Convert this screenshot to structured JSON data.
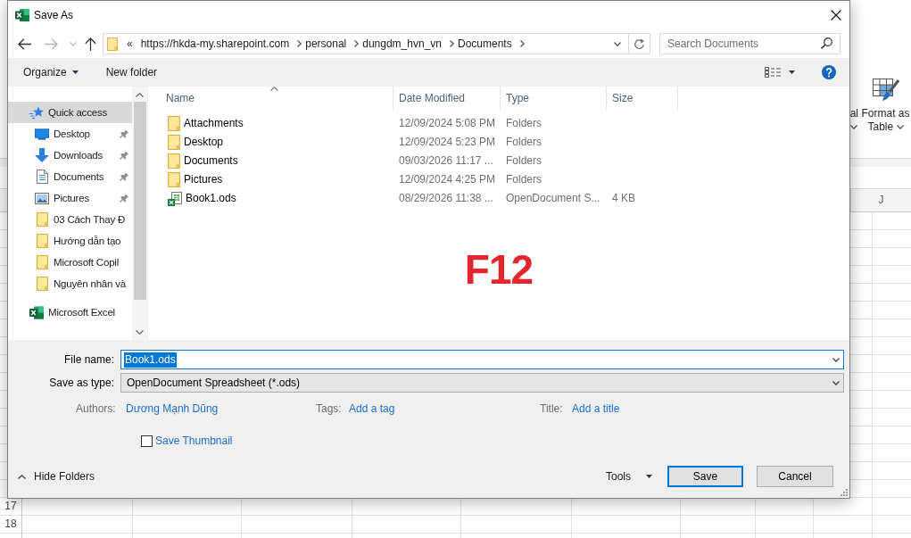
{
  "window": {
    "title": "Save As"
  },
  "nav_buttons": [
    {
      "kind": "back",
      "disabled": false
    },
    {
      "kind": "forward",
      "disabled": true
    },
    {
      "kind": "recent",
      "disabled": true
    },
    {
      "kind": "up",
      "disabled": false
    }
  ],
  "address_bar": {
    "overflow_marker": "«",
    "segments": [
      "https://hkda-my.sharepoint.com",
      "personal",
      "dungdm_hvn_vn",
      "Documents"
    ]
  },
  "search": {
    "placeholder": "Search Documents"
  },
  "toolbar": {
    "organize": "Organize",
    "new_folder": "New folder"
  },
  "sidebar": {
    "items": [
      {
        "kind": "quick-access",
        "label": "Quick access",
        "selected": true,
        "children": [
          {
            "kind": "desktop",
            "label": "Desktop",
            "pinned": true,
            "selected": false
          },
          {
            "kind": "downloads",
            "label": "Downloads",
            "pinned": true,
            "selected": false
          },
          {
            "kind": "documents",
            "label": "Documents",
            "pinned": true,
            "selected": false
          },
          {
            "kind": "pictures",
            "label": "Pictures",
            "pinned": true,
            "selected": false
          },
          {
            "kind": "folder",
            "label": "03 Cách Thay Đ",
            "pinned": false,
            "selected": false
          },
          {
            "kind": "folder",
            "label": "Hướng dẫn tạo",
            "pinned": false,
            "selected": false
          },
          {
            "kind": "folder",
            "label": "Microsoft Copil",
            "pinned": false,
            "selected": false
          },
          {
            "kind": "folder",
            "label": "Nguyên nhân và",
            "pinned": false,
            "selected": false
          }
        ]
      },
      {
        "kind": "excel",
        "label": "Microsoft Excel",
        "selected": false
      }
    ]
  },
  "file_list": {
    "columns": [
      {
        "label": "Name",
        "sorted": true
      },
      {
        "label": "Date Modified",
        "sorted": false
      },
      {
        "label": "Type",
        "sorted": false
      },
      {
        "label": "Size",
        "sorted": false
      }
    ],
    "rows": [
      {
        "kind": "folder",
        "name": "Attachments",
        "date_modified": "12/09/2024 5:08 PM",
        "type": "Folders",
        "selected": false
      },
      {
        "kind": "folder",
        "name": "Desktop",
        "date_modified": "12/09/2024 5:23 PM",
        "type": "Folders",
        "selected": false
      },
      {
        "kind": "folder",
        "name": "Documents",
        "date_modified": "09/03/2026 11:17 ...",
        "type": "Folders",
        "selected": false
      },
      {
        "kind": "folder",
        "name": "Pictures",
        "date_modified": "12/09/2024 4:25 PM",
        "type": "Folders",
        "selected": false
      },
      {
        "kind": "spreadsheet",
        "name": "Book1.ods",
        "date_modified": "08/29/2026 11:38 ...",
        "type": "OpenDocument S...",
        "size": "4 KB",
        "selected": false
      }
    ]
  },
  "annotation": {
    "text": "F12"
  },
  "form": {
    "file_name": {
      "label": "File name:",
      "value": "Book1.ods",
      "focused": true,
      "text_selected": true
    },
    "save_as_type": {
      "label": "Save as type:",
      "value": "OpenDocument Spreadsheet (*.ods)"
    },
    "properties": [
      {
        "label": "Authors:",
        "value": "Dương Mạnh Dũng"
      },
      {
        "label": "Tags:",
        "value": "Add a tag"
      },
      {
        "label": "Title:",
        "value": "Add a title"
      }
    ],
    "save_thumbnail": {
      "label": "Save Thumbnail",
      "checked": false
    }
  },
  "footer": {
    "hide_folders": "Hide Folders",
    "tools": "Tools",
    "buttons": [
      {
        "kind": "default",
        "label": "Save"
      },
      {
        "kind": "normal",
        "label": "Cancel"
      }
    ]
  },
  "background": {
    "ribbon": [
      {
        "kind": "partial",
        "label": "al"
      },
      {
        "kind": "table",
        "label": "Format as Table"
      }
    ],
    "column_headers": [
      "J"
    ],
    "row_numbers": [
      "17",
      "18"
    ]
  }
}
